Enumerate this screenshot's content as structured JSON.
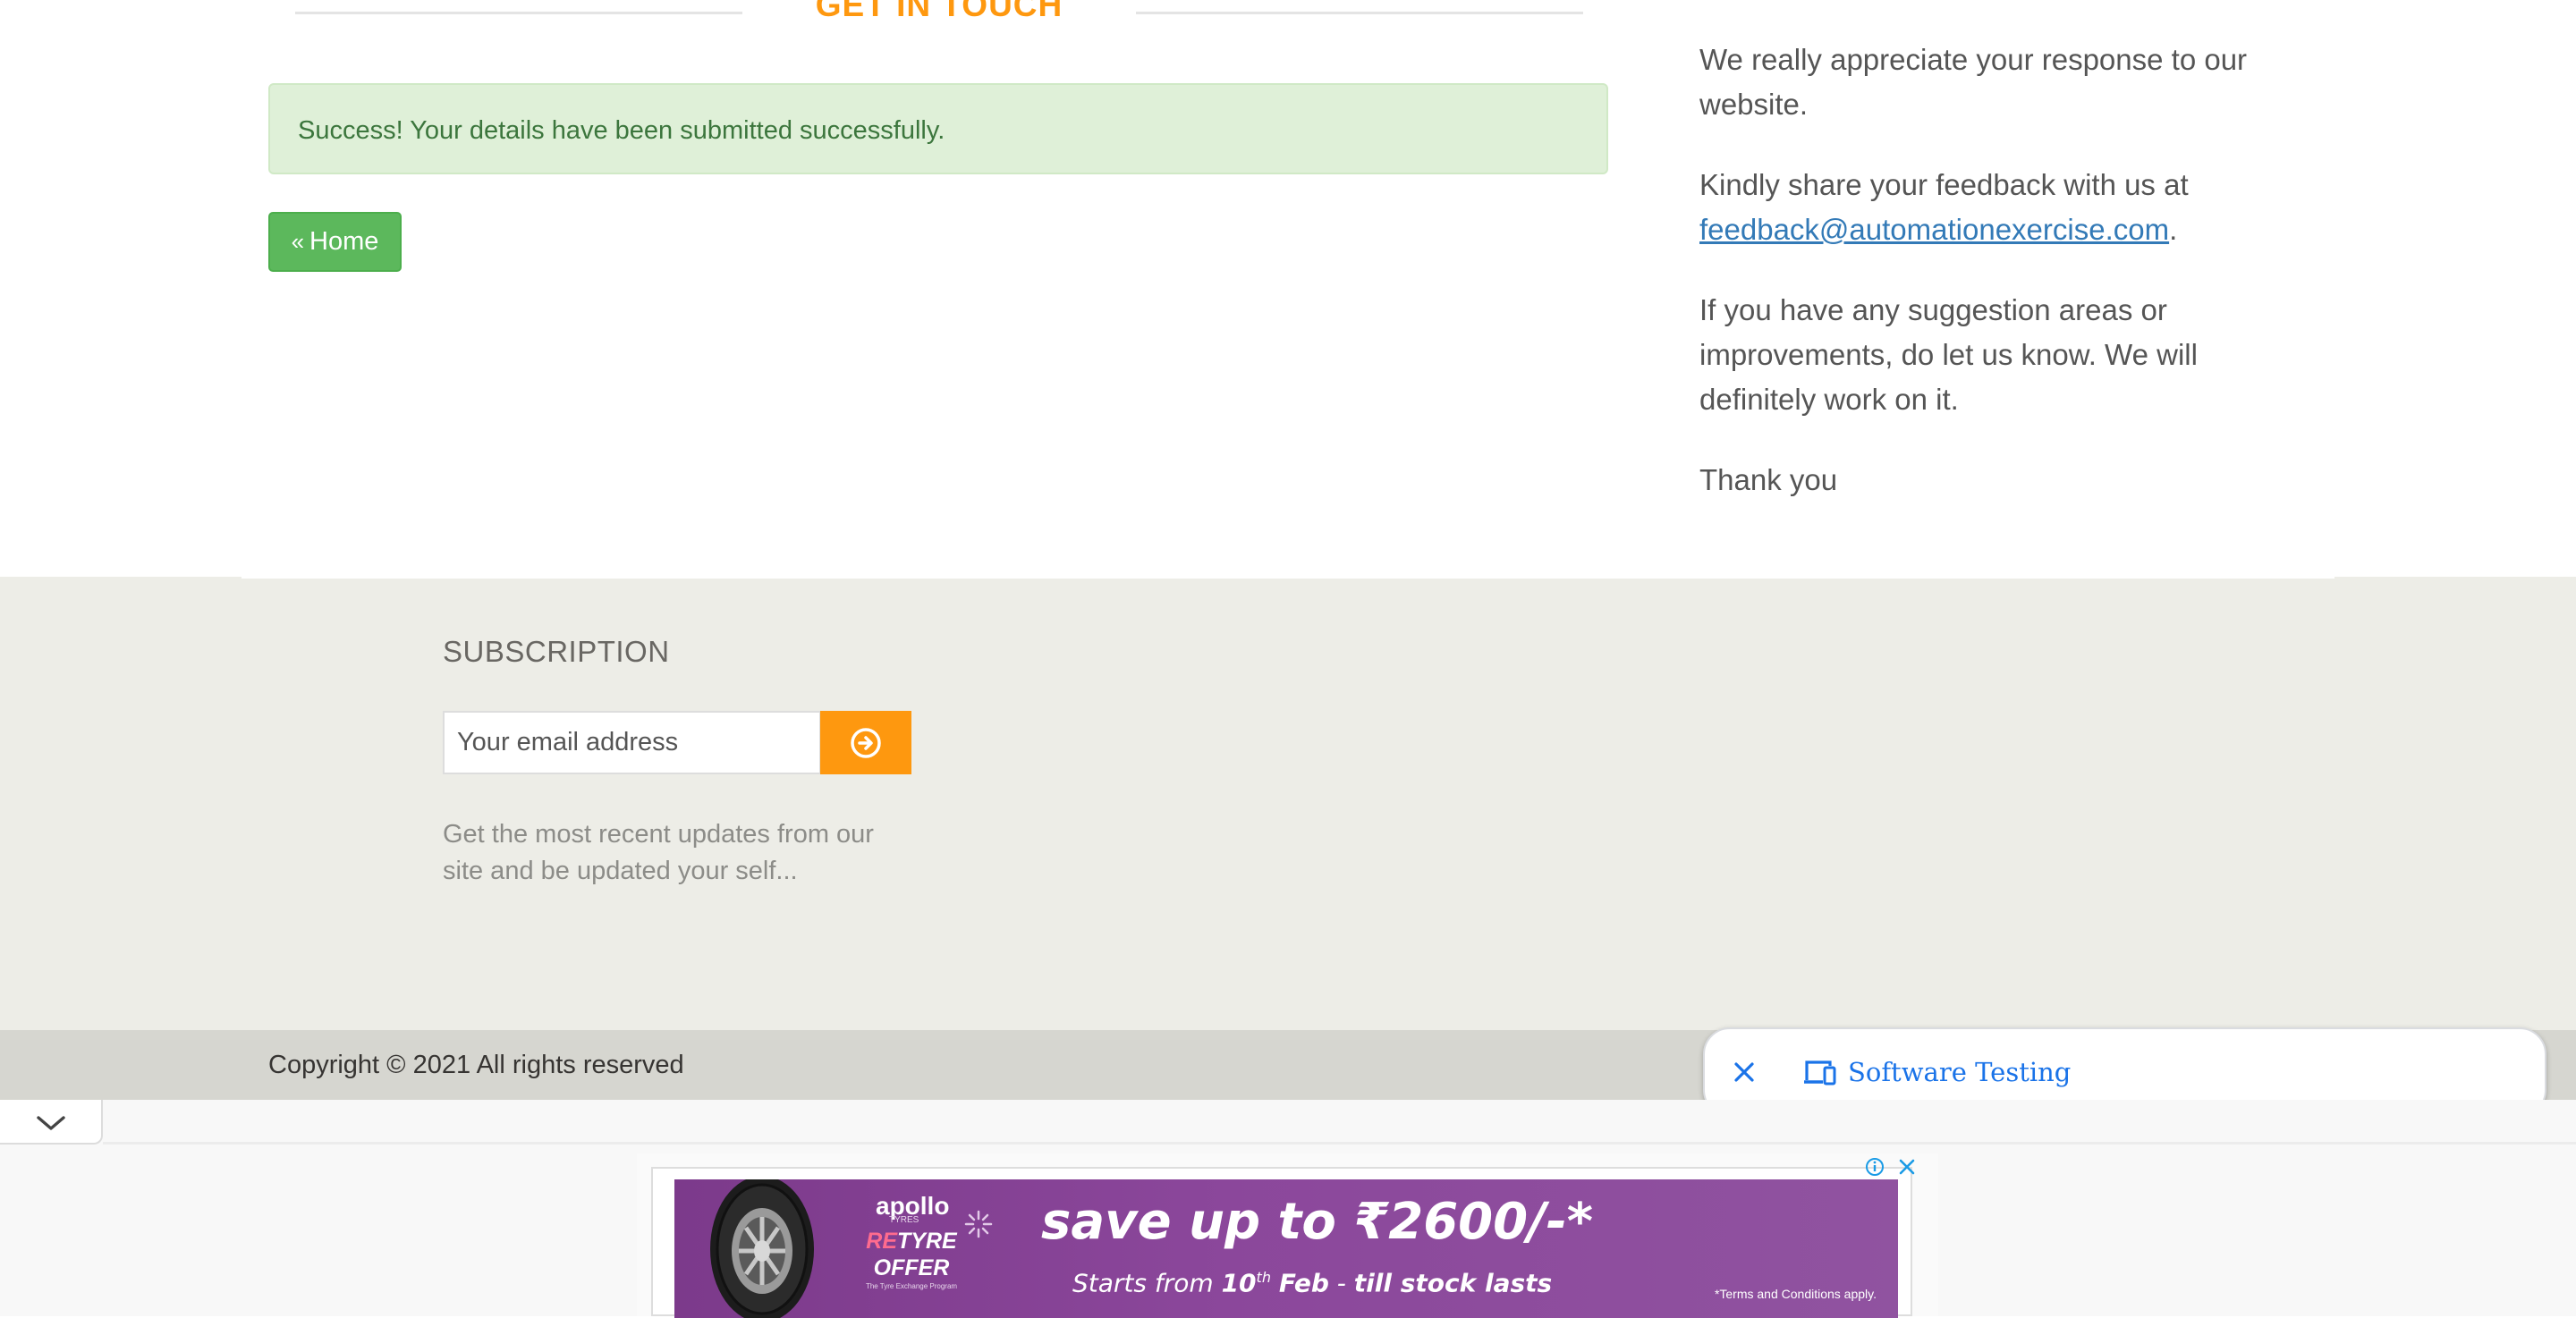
{
  "contact": {
    "section_title": "GET IN TOUCH",
    "alert_message": "Success! Your details have been submitted successfully.",
    "home_button_label": "Home",
    "home_button_icon": "double-chevron-left-icon"
  },
  "feedback": {
    "para1": "We really appreciate your response to our website.",
    "para2_prefix": "Kindly share your feedback with us at",
    "email_link": "feedback@automationexercise.com",
    "para2_suffix": ".",
    "para3": "If you have any suggestion areas or improvements, do let us know. We will definitely work on it.",
    "para4": "Thank you"
  },
  "subscription": {
    "title": "SUBSCRIPTION",
    "email_placeholder": "Your email address",
    "submit_icon": "arrow-circle-right-icon",
    "description": "Get the most recent updates from our site and be updated your self..."
  },
  "footer": {
    "copyright": "Copyright © 2021 All rights reserved"
  },
  "search_chip": {
    "label": "Software Testing",
    "close_icon": "close-icon",
    "device_icon": "devices-icon"
  },
  "ad": {
    "brand": "apollo",
    "brand_sub": "TYRES",
    "offer_re": "RE",
    "offer_tyre": "TYRE",
    "offer_word": "OFFER",
    "offer_tagline": "The Tyre Exchange Program",
    "headline": "save up to ₹2600/-*",
    "subline_prefix": "Starts from",
    "subline_day": "10",
    "subline_sup": "th",
    "subline_month": "Feb",
    "subline_dash": "-",
    "subline_suffix": "till stock lasts",
    "terms": "*Terms and Conditions apply.",
    "info_icon": "info-icon",
    "close_icon": "close-icon"
  },
  "colors": {
    "accent_orange": "#fe980f",
    "success_bg": "#dff0d8",
    "success_text": "#3c763d",
    "button_green": "#5cb85c",
    "link_blue": "#337ab7",
    "footer_bg": "#edede7",
    "footer_bottom_bg": "#d6d6d0",
    "ad_purple": "#8b479b",
    "chip_blue": "#1a73e8"
  }
}
